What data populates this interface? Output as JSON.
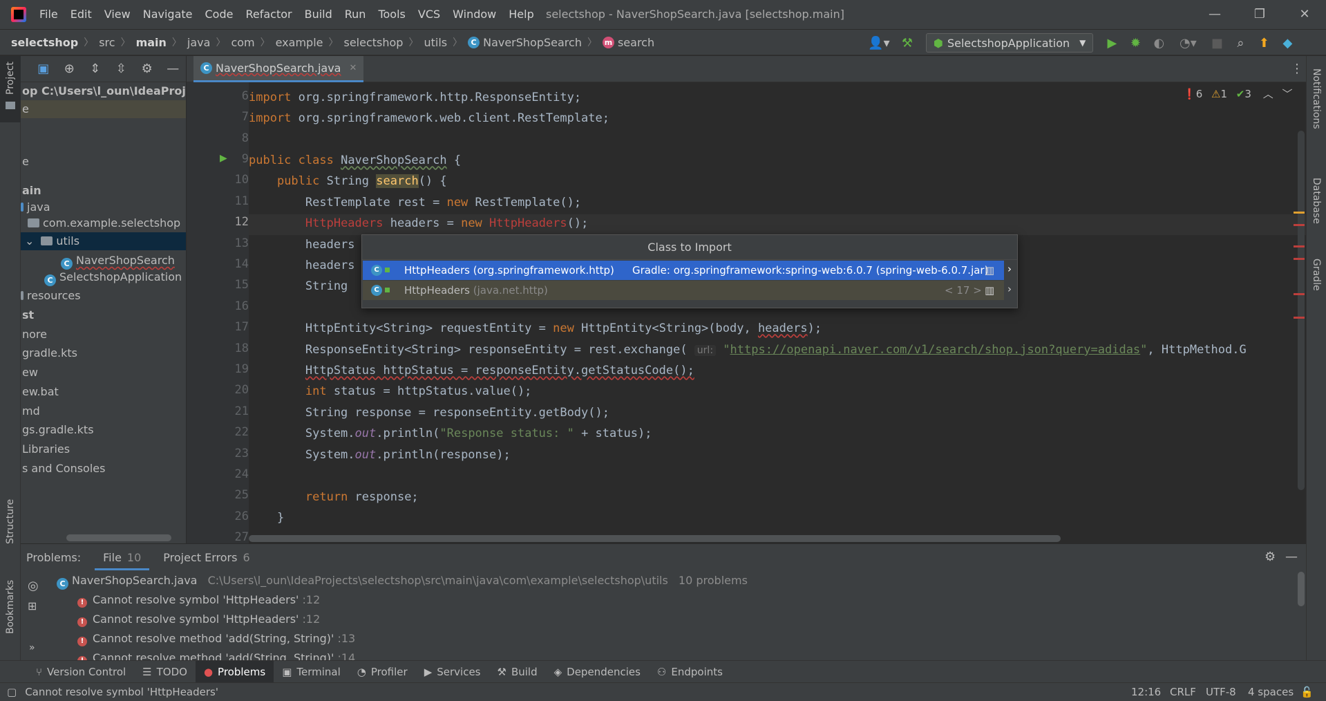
{
  "menu": {
    "items": [
      "File",
      "Edit",
      "View",
      "Navigate",
      "Code",
      "Refactor",
      "Build",
      "Run",
      "Tools",
      "VCS",
      "Window",
      "Help"
    ],
    "window_title": "selectshop - NaverShopSearch.java [selectshop.main]"
  },
  "breadcrumb": [
    "selectshop",
    "src",
    "main",
    "java",
    "com",
    "example",
    "selectshop",
    "utils",
    "NaverShopSearch",
    "search"
  ],
  "run_config": "SelectshopApplication",
  "left_stripe": {
    "project": "Project",
    "structure": "Structure",
    "bookmarks": "Bookmarks"
  },
  "right_stripe": {
    "notifications": "Notifications",
    "database": "Database",
    "gradle": "Gradle"
  },
  "project_tree": [
    {
      "text": "op  C:\\Users\\l_oun\\IdeaProjects\\selectshop",
      "bold": true
    },
    {
      "text": "e"
    },
    {
      "text": ""
    },
    {
      "text": "e"
    },
    {
      "text": ""
    },
    {
      "text": "ain",
      "bold": true
    },
    {
      "text": "java"
    },
    {
      "text": "com.example.selectshop"
    },
    {
      "text": "utils"
    },
    {
      "text": "NaverShopSearch"
    },
    {
      "text": "SelectshopApplication"
    },
    {
      "text": "resources"
    },
    {
      "text": "st",
      "bold": true
    },
    {
      "text": "nore"
    },
    {
      "text": "gradle.kts"
    },
    {
      "text": "ew"
    },
    {
      "text": "ew.bat"
    },
    {
      "text": "md"
    },
    {
      "text": "gs.gradle.kts"
    },
    {
      "text": "Libraries"
    },
    {
      "text": "s and Consoles"
    }
  ],
  "editor": {
    "tab_label": "NaverShopSearch.java",
    "inspection": {
      "errors": "6",
      "warnings": "1",
      "ok": "3"
    },
    "line_numbers": [
      "6",
      "7",
      "8",
      "9",
      "10",
      "11",
      "12",
      "13",
      "14",
      "15",
      "16",
      "17",
      "18",
      "19",
      "20",
      "21",
      "22",
      "23",
      "24",
      "25",
      "26",
      "27"
    ],
    "url_hint": "url:",
    "url": "https://openapi.naver.com/v1/search/shop.json?query=adidas"
  },
  "import_popup": {
    "title": "Class to Import",
    "options": [
      {
        "name": "HttpHeaders",
        "package": "(org.springframework.http)",
        "source": "Gradle: org.springframework:spring-web:6.0.7 (spring-web-6.0.7.jar)"
      },
      {
        "name": "HttpHeaders",
        "package": "(java.net.http)",
        "source": "< 17 >"
      }
    ]
  },
  "problems": {
    "label": "Problems:",
    "tabs": [
      {
        "label": "File",
        "count": "10"
      },
      {
        "label": "Project Errors",
        "count": "6"
      }
    ],
    "file": {
      "name": "NaverShopSearch.java",
      "path": "C:\\Users\\l_oun\\IdeaProjects\\selectshop\\src\\main\\java\\com\\example\\selectshop\\utils",
      "count": "10 problems"
    },
    "items": [
      {
        "text": "Cannot resolve symbol 'HttpHeaders'",
        "line": ":12"
      },
      {
        "text": "Cannot resolve symbol 'HttpHeaders'",
        "line": ":12"
      },
      {
        "text": "Cannot resolve method 'add(String, String)'",
        "line": ":13"
      },
      {
        "text": "Cannot resolve method 'add(String, String)'",
        "line": ":14"
      }
    ]
  },
  "tool_windows": [
    "Version Control",
    "TODO",
    "Problems",
    "Terminal",
    "Profiler",
    "Services",
    "Build",
    "Dependencies",
    "Endpoints"
  ],
  "status": {
    "message": "Cannot resolve symbol 'HttpHeaders'",
    "position": "12:16",
    "line_sep": "CRLF",
    "encoding": "UTF-8",
    "indent": "4 spaces"
  },
  "colors": {
    "accent": "#2f65ca",
    "error": "#bc3f3c",
    "keyword": "#cc7832",
    "string": "#6a8759",
    "background": "#2b2b2b"
  }
}
